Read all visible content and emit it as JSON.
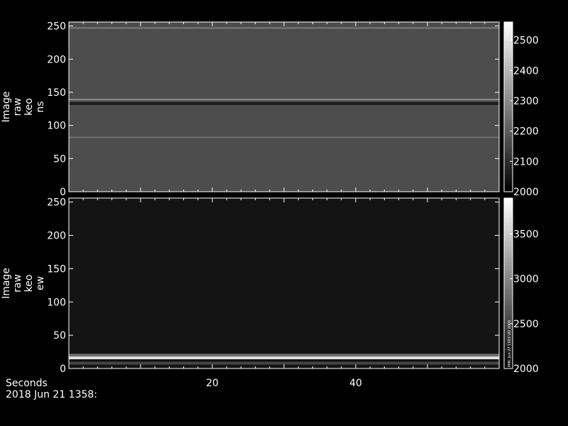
{
  "chart_data": [
    {
      "type": "heatmap",
      "ylabel_lines": [
        "Image",
        "raw",
        "keo",
        "ns"
      ],
      "ylim": [
        0,
        256
      ],
      "yticks": [
        0,
        50,
        100,
        150,
        200,
        250
      ],
      "xlim": [
        0,
        60
      ],
      "colorbar": {
        "range": [
          2000,
          2560
        ],
        "ticks": [
          2000,
          2100,
          2200,
          2300,
          2400,
          2500
        ]
      },
      "base_level": 2170,
      "features": [
        {
          "y": 139,
          "level": 2330,
          "note": "bright line"
        },
        {
          "y": 133,
          "level": 2050,
          "note": "dark band"
        },
        {
          "y": 82,
          "level": 2250,
          "note": "faint line"
        },
        {
          "y": 247,
          "level": 2280,
          "note": "faint line"
        }
      ]
    },
    {
      "type": "heatmap",
      "ylabel_lines": [
        "Image",
        "raw",
        "keo",
        "ew"
      ],
      "ylim": [
        0,
        256
      ],
      "yticks": [
        0,
        50,
        100,
        150,
        200,
        250
      ],
      "xlim": [
        0,
        60
      ],
      "colorbar": {
        "range": [
          2000,
          3900
        ],
        "ticks": [
          2000,
          2500,
          3000,
          3500
        ]
      },
      "colorbar_note": "MIN: Jun 27 1503 UD 2005",
      "base_level": 2150,
      "features": [
        {
          "y": 16,
          "level": 3850,
          "note": "bright band"
        },
        {
          "y": 20,
          "level": 2900,
          "note": "bright band edge"
        },
        {
          "y": 8,
          "level": 2550,
          "note": "lower glow"
        }
      ]
    }
  ],
  "xaxis": {
    "label": "Seconds",
    "ticks": [
      20,
      40
    ]
  },
  "timestamp": "2018 Jun 21 1358:"
}
